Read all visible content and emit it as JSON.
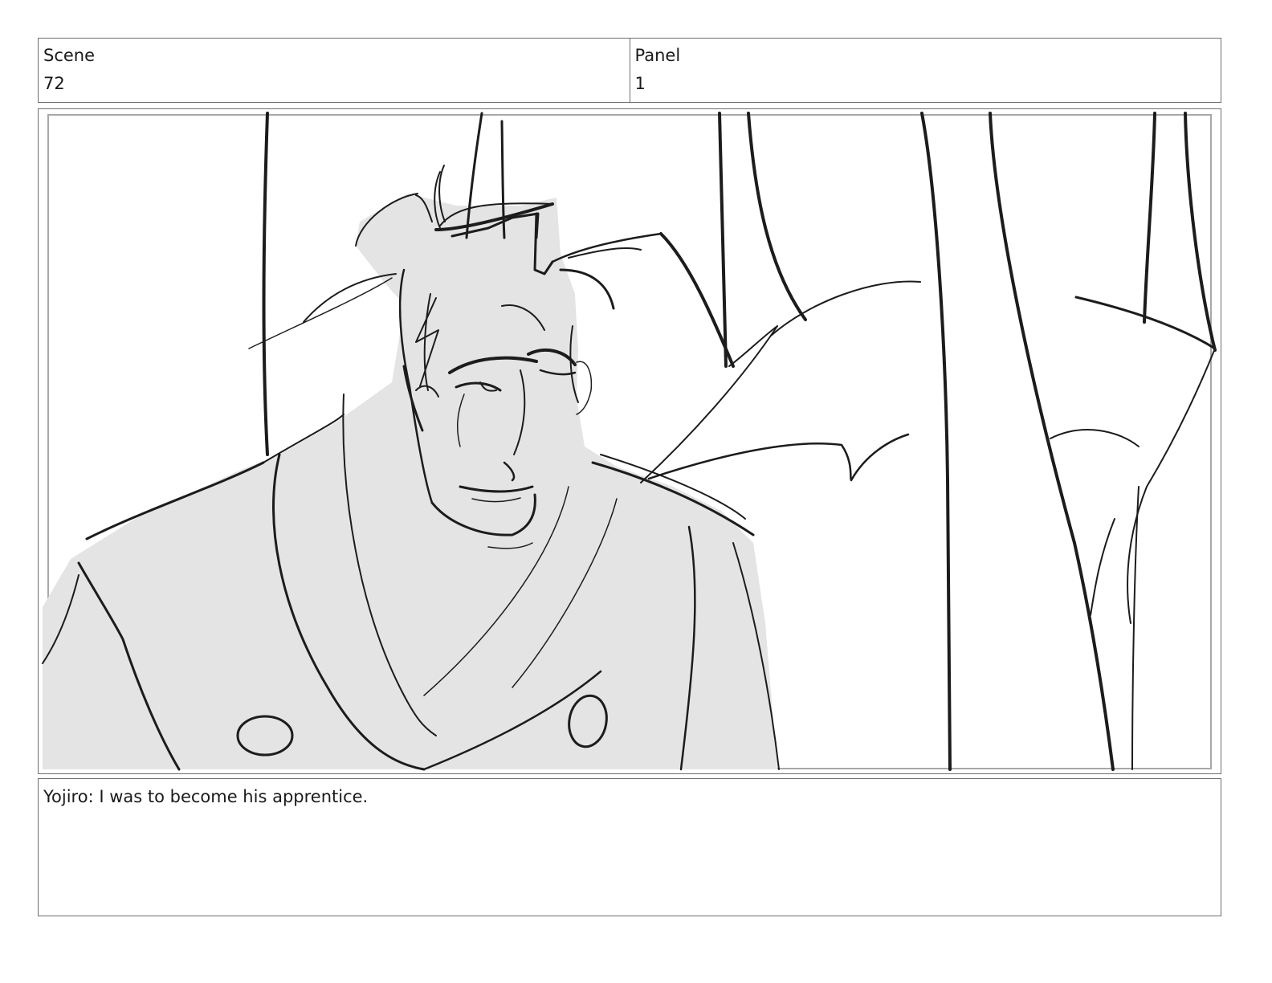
{
  "header": {
    "scene_label": "Scene",
    "scene_value": "72",
    "panel_label": "Panel",
    "panel_value": "1"
  },
  "panel": {
    "image_name": "storyboard-sketch",
    "fill_color": "#e4e4e4",
    "stroke_color": "#1c1c1c",
    "frame_color": "#a8a8a8"
  },
  "caption": {
    "text": "Yojiro: I was to become his apprentice."
  }
}
